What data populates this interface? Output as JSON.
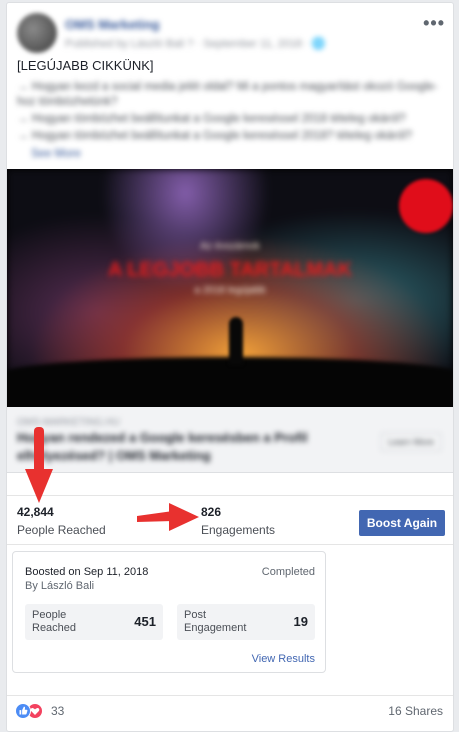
{
  "post": {
    "page_name": "OMS Marketing",
    "meta": "Published by László Bali ? · September 11, 2018 · 🌐",
    "heading": "[LEGÚJABB CIKKÜNK]",
    "lines": [
      "→ Hogyan kezd a social media jelét oldal? Mi a pontos magyarítást okozó Google-",
      "hoz tömbözhetünk?",
      "→ Hogyan tömbözhet beállítunkat a Google kereséssel 2018 tételeg okáról?",
      "→ Hogyan tömbözhet beállítunkat a Google kereséssel 2018? tételeg okáról?"
    ],
    "see_more": "See More"
  },
  "media": {
    "line1": "Az évszámok",
    "line2": "A LEGJOBB TARTALMAK",
    "line3": "a 2018 legújabb",
    "badge_color": "#e00d1a"
  },
  "link": {
    "domain": "OMS-MARKETING.HU",
    "title": "Hogyan rendezed a Google keresésben a Profil elhelyezésed? | OMS Marketing",
    "button": "Learn More"
  },
  "stats": {
    "people_reached_value": "42,844",
    "people_reached_label": "People Reached",
    "engagements_value": "826",
    "engagements_label": "Engagements",
    "boost_again": "Boost Again",
    "accent_color": "#4267b2",
    "arrow_color": "#e8312f"
  },
  "boost": {
    "date": "Boosted on Sep 11, 2018",
    "by": "By László Bali",
    "status": "Completed",
    "metrics": [
      {
        "label_line1": "People",
        "label_line2": "Reached",
        "value": "451"
      },
      {
        "label_line1": "Post",
        "label_line2": "Engagement",
        "value": "19"
      }
    ],
    "view_results": "View Results"
  },
  "footer": {
    "reaction_icons": [
      "like-icon",
      "love-icon"
    ],
    "reaction_count": "33",
    "shares": "16 Shares"
  }
}
